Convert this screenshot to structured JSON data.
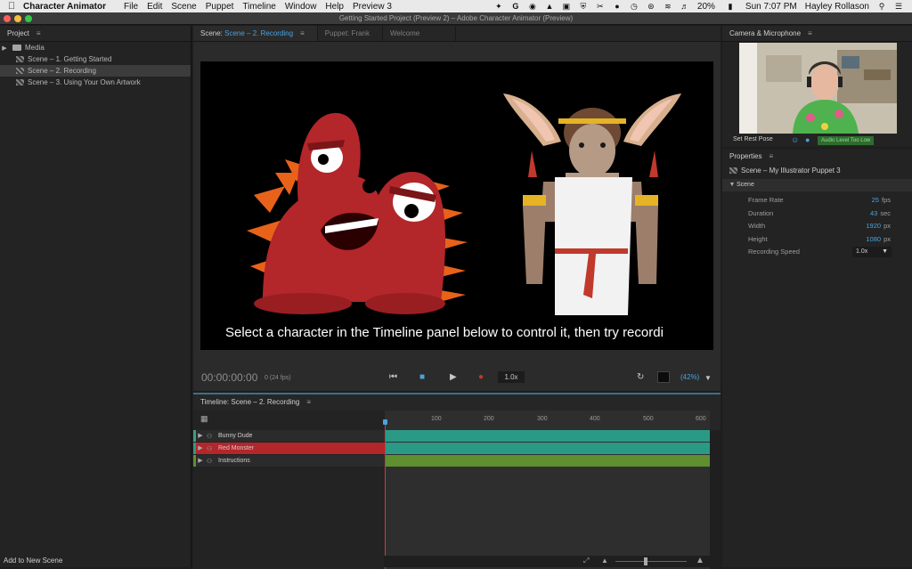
{
  "menubar": {
    "app_name": "Character Animator",
    "menus": [
      "File",
      "Edit",
      "Scene",
      "Puppet",
      "Timeline",
      "Window",
      "Help",
      "Preview 3"
    ],
    "battery": "20%",
    "clock": "Sun 7:07 PM",
    "user": "Hayley Rollason"
  },
  "window": {
    "title": "Getting Started Project (Preview 2) – Adobe Character Animator (Preview)"
  },
  "project": {
    "header": "Project",
    "items": [
      {
        "label": "Media",
        "type": "folder"
      },
      {
        "label": "Scene – 1. Getting Started",
        "type": "scene"
      },
      {
        "label": "Scene – 2. Recording",
        "type": "scene",
        "selected": true
      },
      {
        "label": "Scene – 3. Using Your Own Artwork",
        "type": "scene"
      }
    ],
    "add_new_scene": "Add to New Scene"
  },
  "scene_panel": {
    "tabs": [
      {
        "prefix": "Scene:",
        "label": "Scene – 2. Recording",
        "active": true
      },
      {
        "prefix": "",
        "label": "Puppet: Frank",
        "active": false
      },
      {
        "prefix": "",
        "label": "Welcome",
        "active": false
      }
    ],
    "caption": "Select a character in the Timeline panel below to control it, then try recordi",
    "timecode": "00:00:00:00",
    "fps": "0 (24 fps)",
    "speed": "1.0x",
    "zoom": "(42%)"
  },
  "timeline": {
    "header": "Timeline: Scene – 2. Recording",
    "ruler_ticks": [
      "100",
      "200",
      "300",
      "400",
      "500",
      "600"
    ],
    "tracks": [
      {
        "label": "Bunny Dude",
        "color": "#2a9a86",
        "selected": false
      },
      {
        "label": "Red Monster",
        "color": "#2a9a86",
        "selected": true
      },
      {
        "label": "Instructions",
        "color": "#5f8f2f",
        "selected": false
      }
    ]
  },
  "camera": {
    "header": "Camera & Microphone",
    "set_rest_pose": "Set Rest Pose",
    "audio_status": "Audio Level Too Low"
  },
  "properties": {
    "header": "Properties",
    "object": "Scene – My Illustrator Puppet 3",
    "section": "Scene",
    "rows": [
      {
        "key": "Frame Rate",
        "value": "25",
        "unit": "fps"
      },
      {
        "key": "Duration",
        "value": "43",
        "unit": "sec"
      },
      {
        "key": "Width",
        "value": "1920",
        "unit": "px"
      },
      {
        "key": "Height",
        "value": "1080",
        "unit": "px"
      }
    ],
    "recording_speed_label": "Recording Speed",
    "recording_speed_value": "1.0x"
  },
  "colors": {
    "accent": "#4aa3df",
    "record": "#c0392b",
    "monster": "#b3262a",
    "selected_track": "#b3262a"
  }
}
